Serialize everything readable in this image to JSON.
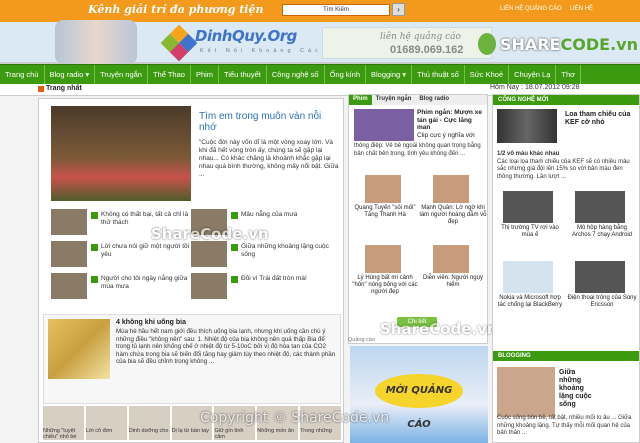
{
  "header": {
    "tagline": "Kênh giải trí đa phương tiện",
    "search_placeholder": "Tìm Kiếm",
    "links": [
      "LIÊN HỆ QUẢNG CÁO",
      "LIÊN HỆ"
    ]
  },
  "banner": {
    "logo_text": "DinhQuy.Org",
    "logo_sub": "Kết Nối Khoảng Cách",
    "ad_text": "liên hệ quảng cáo",
    "ad_phone": "01689.069.162"
  },
  "watermark": {
    "brand": "SHARE",
    "brand2": "CODE.vn",
    "over": "ShareCode.vn",
    "copyright": "Copyright © ShareCode.vn"
  },
  "nav": [
    "Trang chủ",
    "Blog radio ▾",
    "Truyện ngắn",
    "Thể Thao",
    "Phim",
    "Tiểu thuyết",
    "Công nghệ số",
    "Ống kính",
    "Blogging ▾",
    "Thủ thuật số",
    "Sức Khoẻ",
    "Chuyện Lạ",
    "Thơ"
  ],
  "subbar": {
    "title": "Trang nhất",
    "date": "Hôm Nay : 18.07.2012 09:28"
  },
  "featured": {
    "title": "Tìm em trong muôn vàn nỗi nhớ",
    "summary": "\"Cuộc đời này vốn dĩ là một vòng xoay lớn. Và khi đã hết vòng tròn ấy, chúng ta sẽ gặp lại nhau... Có khác chăng là khoảnh khắc gặp lại nhau quá bình thường, không mấy nổi bật. Giữa ...",
    "related": [
      "Không có thất bại, tất cả chỉ là thử thách",
      "Mâu nẵng của mưa",
      "Lời chưa nói giữ một người tồi yêu",
      "Giữa những khoảng lặng cuộc sống",
      "Người cho tôi ngày nắng giữa mùa mưa",
      "Đôi vì Trái đất tròn mà!"
    ]
  },
  "article2": {
    "title": "4 không khi uống bia",
    "summary": "Mùa hè hầu hết nam giới đều thích uống bia lạnh, nhưng khi uống cần chú ý những điều \"không nên\" sau: 1. Nhiệt độ của bia không nên quá thấp Bia để trong tủ lạnh nên khống chế ở nhiệt độ từ 5-10oC bởi vì độ hòa tan của CO2 hàm chứa trong bia sẽ biến đổi tăng hay giảm tùy theo nhiệt độ, các thành phần của bia sẽ đều chỉnh trong không ...",
    "strip": [
      "Những \"tuyệt chiêu\" nhỏ bé",
      "Lời cô đơn",
      "Dinh dưỡng cho",
      "Dị lạ từ bàn tay",
      "Giữ gìn tình cảm",
      "Những món ăn",
      "Trong những"
    ]
  },
  "middle": {
    "tabs": [
      "Phim",
      "Truyện ngắn",
      "Blog radio"
    ],
    "video_title": "Phim ngắn: Mượn xe tán gái - Cực lãng man",
    "video_sub": "Clip cực ý nghĩa với",
    "video_sum": "thông điệp: Vẻ bề ngoài không quan trọng bằng bản chất bên trong, tình yêu không đến ...",
    "grid": [
      "Quang Tuyến \"sỏi mối\" Tăng Thanh Hà",
      "Mạnh Quân: Lờ ngờ khi làm người hoàng dẫm vỗ đẹp",
      "Lý Hùng bất mí cảnh \"hôn\" nóng bỏng với các người đẹp",
      "Diễn viên: Người ngụy hiểm"
    ],
    "more": "Chi tiết",
    "ad_label": "Quảng cáo",
    "ad_big": "MỜI QUẢNG CÁO"
  },
  "right": {
    "head1": "CÔNG NGHỆ MỚI",
    "spk_title": "Loa tham chiếu của KEF cỡ nhỏ",
    "spk_sub": "1/2 vô màu khác nhau",
    "spk_sum": "Các loại loa tham chiếu của KEF sẽ có nhiều màu sắc nhưng giá đội lên 15% so với bản màu đen thông thường. Lần lượt ...",
    "grid": [
      "Thị trường TV rơi vào mùa ế",
      "Mô hộp hàng bằng Archos 7 chạy Android",
      "Nokia và Microsoft hợp tác chống lại BlackBerry",
      "Điện thoại trông của Sony Ericsson"
    ],
    "head2": "BLOGGING",
    "g_title": "Giữa những khoảng lặng cuộc sống",
    "g_sum": "Cuộc sống bôn bề, tất bật, nhiều mối lo âu ... Giữa những khoảng lặng. Tự thấy mỗi mối quan hệ của bản thân ..."
  }
}
